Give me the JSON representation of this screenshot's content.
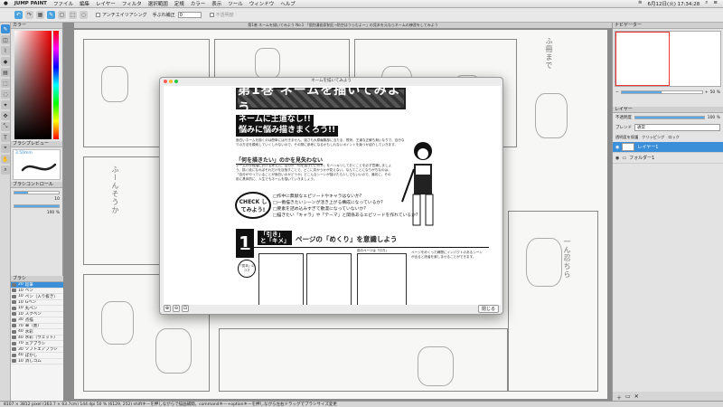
{
  "menubar": {
    "app": "JUMP PAINT",
    "items": [
      "ファイル",
      "編集",
      "レイヤー",
      "フィルタ",
      "選択範囲",
      "定規",
      "カラー",
      "表示",
      "ツール",
      "ウィンドウ",
      "ヘルプ"
    ],
    "time": "6月12日(火) 17:34:28"
  },
  "toolbar": {
    "antialias_label": "アンチエイリアシング",
    "correction_label": "手ぶれ補正",
    "correction_value": "0",
    "transparency_label": "不透明度"
  },
  "document": {
    "title": "第1巻 ネームを描いてみよう No.1 「個別漫画家制圧→防空はうらむよ～」の見本を元ならネームの練習をしてみよう"
  },
  "left_panel": {
    "color_title": "カラー",
    "brush_preview_title": "ブラシプレビュー",
    "brush_size": "3.50mm",
    "brush_control_title": "ブラシコントロール",
    "size_value": "10",
    "opacity_value": "100 %",
    "opacity_fraction": 1.0,
    "size_fraction": 0.3,
    "brush_list_title": "ブラシ",
    "brushes": [
      {
        "num": "20",
        "name": "鉛筆",
        "selected": true
      },
      {
        "num": "10",
        "name": "ペン",
        "selected": false
      },
      {
        "num": "10",
        "name": "ペン（入り抜き）",
        "selected": false
      },
      {
        "num": "10",
        "name": "Gペン",
        "selected": false
      },
      {
        "num": "10",
        "name": "丸ペン",
        "selected": false
      },
      {
        "num": "10",
        "name": "スクペン",
        "selected": false
      },
      {
        "num": "30",
        "name": "点描",
        "selected": false
      },
      {
        "num": "70",
        "name": "筆（墨）",
        "selected": false
      },
      {
        "num": "40",
        "name": "水彩",
        "selected": false
      },
      {
        "num": "40",
        "name": "水彩（ウェット）",
        "selected": false
      },
      {
        "num": "70",
        "name": "エアブラシ",
        "selected": false
      },
      {
        "num": "30",
        "name": "ソフトエアブラシ",
        "selected": false
      },
      {
        "num": "40",
        "name": "ぼかし",
        "selected": false
      },
      {
        "num": "10",
        "name": "消しゴム",
        "selected": false
      }
    ]
  },
  "modal": {
    "title": "ネームを描いてみよう",
    "banner": "第1巻 ネームを描いてみよう",
    "headline1": "ネームに王道なし!!",
    "headline2": "悩みに悩み描きまくろう!!",
    "intro": "面白いネームを描くのは簡単には行きません。強さも大原編集部に当たる、根気、王道な正解も無いなりで、自分なりの方法を模索していくしかないので、その際に参考になるかもしれないポイントを幾つか紹介していきます。",
    "section1": "「何を描きたい」のかを見失わない",
    "section1_body": "ネームの作段階に於ける考え方。自分が「何を描きたいのか」をハッキリしておくことを必ず意識しましょう。描く段になればそれだけを目指すことで、どこに向かうかが見えない。なんてことになりがちなのは、「自分がやっていることが面白いのかどうか」どこんなシーンが描けたら少しでもいいので、最初に、その前に具体的に、人生でもネームを描いていきましょう。",
    "check_label": "CHECK してみよう!",
    "checks": [
      "□作中に無駄なエピソードやキャラはないか?",
      "□一番描きたいシーンが活き上がる構成になっているか?",
      "□要素を詰め込みすぎて散漫になっていないか?",
      "□描きたい「キャラ」や「テーマ」と関係あるエピソードを作れているか?"
    ],
    "num": "1",
    "hook_label": "「引き」と「キメ」",
    "hook_title": "ページの「めくり」を意識しよう",
    "side_text": "ページをめくった瞬間にインパクトのあるシーンが出ると読者を楽しませることができます。",
    "panel_tag": "「見本」のコマ",
    "arrow_tag": "前のページは「引き」"
  },
  "modal_footer": {
    "close": "閉じる"
  },
  "right_panel": {
    "navigator_title": "ナビゲーター",
    "zoom_value": "50 %",
    "layer_title": "レイヤー",
    "opacity_label": "不透明度",
    "opacity_value": "100 %",
    "blend_label": "ブレンド",
    "blend_value": "通常",
    "clip_label": "透明度を保護",
    "clipping_label": "クリッピング",
    "lock_label": "ロック",
    "layers": [
      {
        "name": "レイヤー1",
        "selected": true
      },
      {
        "name": "フォルダー1",
        "selected": false
      }
    ]
  },
  "statusbar": {
    "text": "8107 × 3812 pixel  (363.7 × 63.7cm)  144 dpi  50 %  (6129, 252)  shiftキーを押しながらで描画補間。commandキー+optionキーを押しながら左右ドラッグでブラシサイズ変更"
  }
}
